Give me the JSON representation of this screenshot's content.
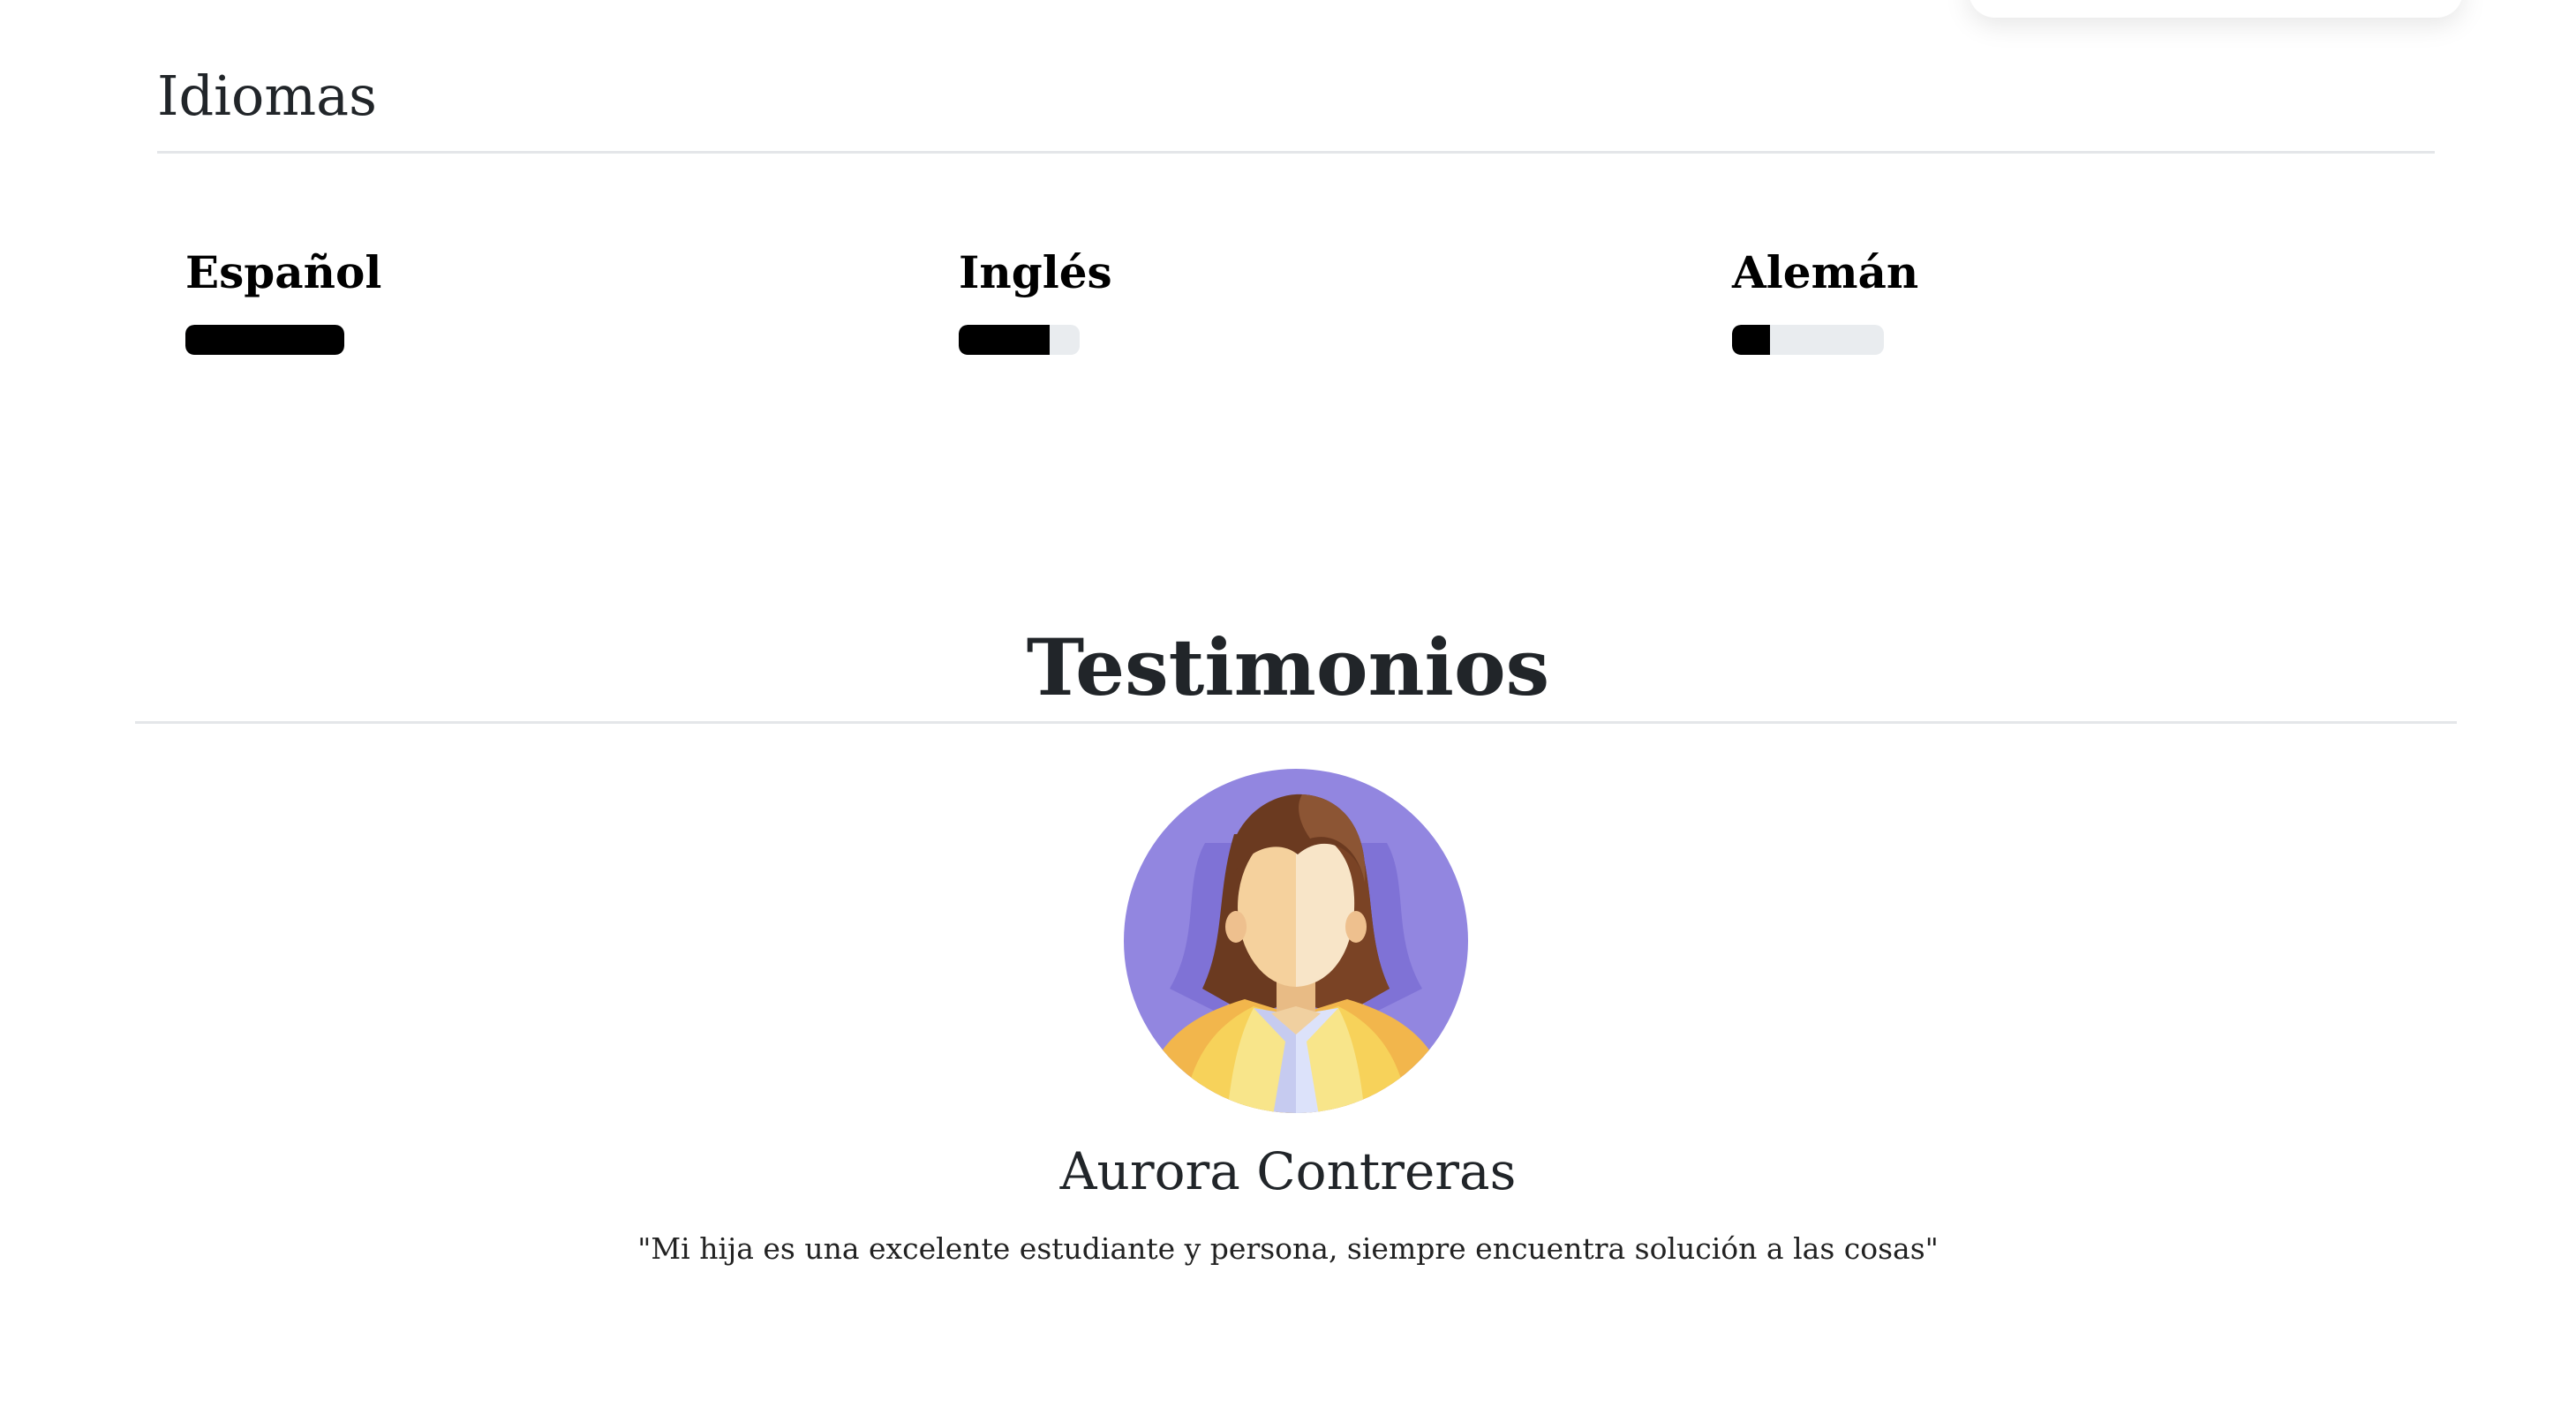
{
  "languages": {
    "title": "Idiomas",
    "items": [
      {
        "name": "Español",
        "level": 1.0
      },
      {
        "name": "Inglés",
        "level": 0.75
      },
      {
        "name": "Alemán",
        "level": 0.25
      }
    ]
  },
  "testimonials": {
    "title": "Testimonios",
    "items": [
      {
        "avatar_icon": "woman-avatar-icon",
        "name": "Aurora Contreras",
        "quote": "\"Mi hija es una excelente estudiante y persona, siempre encuentra solución a las cosas\""
      }
    ]
  },
  "colors": {
    "bar_fill": "#000000",
    "bar_track": "#e9ecef",
    "avatar_background": "#9286e0",
    "jacket": "#f7d25a",
    "hair": "#7a4325"
  }
}
